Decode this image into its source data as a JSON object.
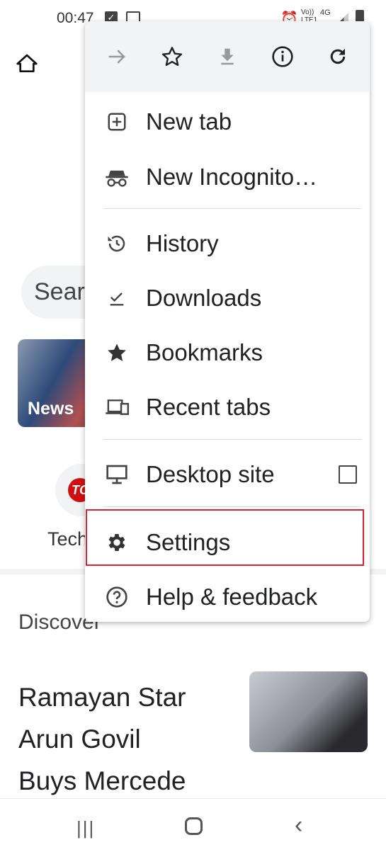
{
  "status_bar": {
    "time": "00:47",
    "network": "4G",
    "volte": "Vo)) LTE1"
  },
  "background": {
    "search_placeholder": "Sear",
    "news_tile": "News",
    "shortcut_label": "Tech",
    "shortcut_logo": "TC",
    "discover": "Discover",
    "headline": [
      "Ramayan Star",
      "Arun Govil",
      "Buys Mercede"
    ]
  },
  "menu": {
    "toolbar": [
      "forward-icon",
      "bookmark-star-icon",
      "download-icon",
      "info-icon",
      "reload-icon"
    ],
    "items": [
      {
        "label": "New tab",
        "icon": "new-tab-icon"
      },
      {
        "label": "New Incognito…",
        "icon": "incognito-icon"
      },
      {
        "label": "History",
        "icon": "history-icon"
      },
      {
        "label": "Downloads",
        "icon": "downloads-icon"
      },
      {
        "label": "Bookmarks",
        "icon": "bookmarks-icon"
      },
      {
        "label": "Recent tabs",
        "icon": "recent-tabs-icon"
      },
      {
        "label": "Desktop site",
        "icon": "desktop-icon",
        "checked": false
      },
      {
        "label": "Settings",
        "icon": "gear-icon",
        "highlighted": true
      },
      {
        "label": "Help & feedback",
        "icon": "help-icon"
      }
    ],
    "highlight_color": "#e02030"
  }
}
